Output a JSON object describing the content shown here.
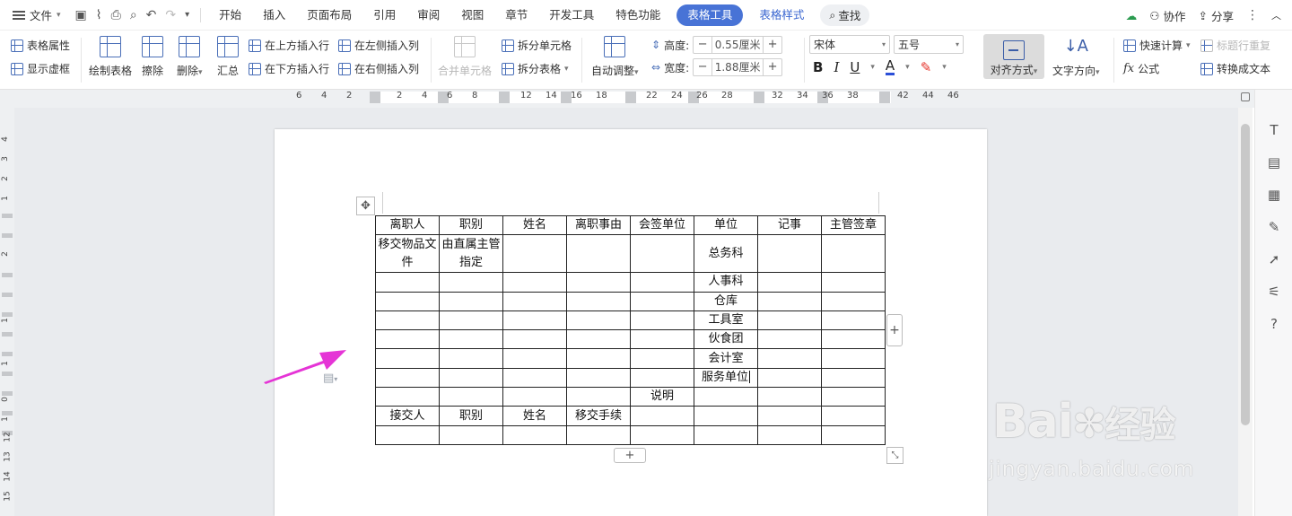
{
  "menubar": {
    "file_label": "文件",
    "tabs": [
      "开始",
      "插入",
      "页面布局",
      "引用",
      "审阅",
      "视图",
      "章节",
      "开发工具",
      "特色功能"
    ],
    "active_tab": "表格工具",
    "secondary_tab": "表格样式",
    "search_label": "查找",
    "collab_label": "协作",
    "share_label": "分享"
  },
  "ribbon": {
    "table_props": "表格属性",
    "show_gridlines": "显示虚框",
    "draw_table": "绘制表格",
    "erase": "擦除",
    "delete": "删除",
    "summarize": "汇总",
    "insert_row_above": "在上方插入行",
    "insert_row_below": "在下方插入行",
    "insert_col_left": "在左侧插入列",
    "insert_col_right": "在右侧插入列",
    "merge_cells": "合并单元格",
    "split_cells": "拆分单元格",
    "split_table": "拆分表格",
    "auto_fit": "自动调整",
    "height_label": "高度:",
    "height_value": "0.55厘米",
    "width_label": "宽度:",
    "width_value": "1.88厘米",
    "font_name": "宋体",
    "font_size": "五号",
    "bold": "B",
    "italic": "I",
    "underline": "U",
    "font_color": "A",
    "align_label": "对齐方式",
    "text_direction": "文字方向",
    "quick_calc": "快速计算",
    "title_row_repeat": "标题行重复",
    "formula": "公式",
    "convert_to_text": "转换成文本"
  },
  "ruler": {
    "h_ticks": [
      "6",
      "4",
      "2",
      "2",
      "4",
      "6",
      "8",
      "12",
      "14",
      "16",
      "18",
      "22",
      "24",
      "26",
      "28",
      "32",
      "34",
      "36",
      "38",
      "42",
      "44",
      "46"
    ],
    "v_ticks": [
      "4",
      "3",
      "2",
      "1",
      "2",
      "1",
      "1",
      "0",
      "1",
      "12",
      "13",
      "14",
      "15"
    ]
  },
  "table": {
    "rows": [
      [
        "离职人",
        "职别",
        "姓名",
        "离职事由",
        "会签单位",
        "单位",
        "记事",
        "主管签章"
      ],
      [
        "移交物品文件",
        "由直属主管指定",
        "",
        "",
        "",
        "总务科",
        "",
        ""
      ],
      [
        "",
        "",
        "",
        "",
        "",
        "人事科",
        "",
        ""
      ],
      [
        "",
        "",
        "",
        "",
        "",
        "仓库",
        "",
        ""
      ],
      [
        "",
        "",
        "",
        "",
        "",
        "工具室",
        "",
        ""
      ],
      [
        "",
        "",
        "",
        "",
        "",
        "伙食团",
        "",
        ""
      ],
      [
        "",
        "",
        "",
        "",
        "",
        "会计室",
        "",
        ""
      ],
      [
        "",
        "",
        "",
        "",
        "",
        "服务单位",
        "",
        ""
      ],
      [
        "",
        "",
        "",
        "",
        "说明",
        "",
        "",
        ""
      ],
      [
        "接交人",
        "职别",
        "姓名",
        "移交手续",
        "",
        "",
        "",
        ""
      ],
      [
        "",
        "",
        "",
        "",
        "",
        "",
        "",
        ""
      ]
    ]
  },
  "controls": {
    "add_col": "+",
    "add_row": "+",
    "move": "✥"
  },
  "watermark": {
    "brand": "Bai",
    "brand_cn": "经验",
    "domain": "jingyan.baidu.com"
  },
  "colors": {
    "accent": "#4873d6",
    "arrow": "#e534d6"
  }
}
